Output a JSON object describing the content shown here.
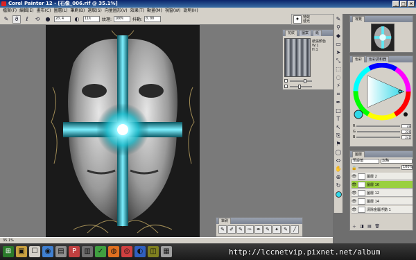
{
  "window": {
    "title": "Corel Painter 12 - [石像_006.rif @ 35.1%]",
    "controls": [
      "_",
      "□",
      "×"
    ]
  },
  "menubar": {
    "items": [
      "檔案(F)",
      "編輯(E)",
      "畫布(C)",
      "圖層(L)",
      "筆刷(B)",
      "選取(S)",
      "向量圖形(V)",
      "效果(T)",
      "動畫(M)",
      "視窗(W)",
      "說明(H)"
    ]
  },
  "propbar": {
    "size_value": "20.4",
    "opacity_value": "11%",
    "grain_label": "紋理:",
    "grain_value": "100%",
    "jitter_label": "抖動:",
    "jitter_value": "0.00"
  },
  "brush_selector": {
    "line1": "特效",
    "line2": "發光"
  },
  "texture_panel": {
    "tabs": [
      "花紋",
      "圖案",
      "紙"
    ],
    "info_lines": [
      "紙張顏色",
      "W:1",
      "H:1"
    ]
  },
  "navigator_panel": {
    "tabs": [
      "導覽"
    ]
  },
  "color_panel": {
    "tabs": [
      "色彩",
      "色彩調和器"
    ],
    "current_color": "#30d8e8",
    "rgb": [
      {
        "label": "R",
        "value": "49"
      },
      {
        "label": "G",
        "value": "226"
      },
      {
        "label": "B",
        "value": "241"
      }
    ]
  },
  "layers_panel": {
    "tabs": [
      "圖層"
    ],
    "composite_method": "預設值",
    "composite_depth": "忽略",
    "opacity": "100%",
    "layers": [
      {
        "name": "圖層 2",
        "active": false
      },
      {
        "name": "圖層 16",
        "active": true
      },
      {
        "name": "圖層 12",
        "active": false
      },
      {
        "name": "圖層 14",
        "active": false
      },
      {
        "name": "清除金屬浮動 1",
        "active": false
      }
    ]
  },
  "brushbar": {
    "title": "筆刷"
  },
  "statusbar": {
    "zoom": "35.1%"
  },
  "watermark": {
    "text": "http://lccnetvip.pixnet.net/album"
  },
  "colors": {
    "accent": "#30d8e8",
    "active_layer": "#9ad040",
    "title_bar": "#0a246a"
  }
}
